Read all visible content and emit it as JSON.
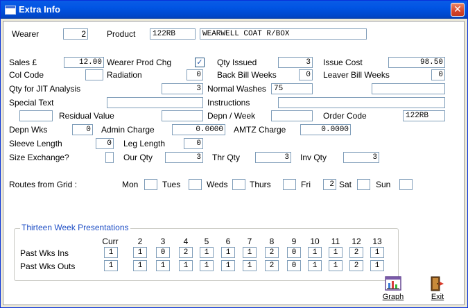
{
  "window": {
    "title": "Extra Info",
    "close_glyph": "✕"
  },
  "wearer": {
    "label": "Wearer",
    "value": "2"
  },
  "product": {
    "label": "Product",
    "code": "122RB",
    "description": "WEARWELL COAT R/BOX"
  },
  "sales": {
    "label": "Sales £",
    "value": "12.00"
  },
  "wearer_prod_chg": {
    "label": "Wearer Prod Chg",
    "checked_glyph": "✓"
  },
  "qty_issued": {
    "label": "Qty Issued",
    "value": "3"
  },
  "issue_cost": {
    "label": "Issue Cost",
    "value": "98.50"
  },
  "col_code": {
    "label": "Col Code",
    "value": ""
  },
  "radiation": {
    "label": "Radiation",
    "value": "0"
  },
  "back_bill_weeks": {
    "label": "Back Bill Weeks",
    "value": "0"
  },
  "leaver_bill_weeks": {
    "label": "Leaver Bill Weeks",
    "value": "0"
  },
  "qty_jit": {
    "label": "Qty for JIT Analysis",
    "value": "3"
  },
  "normal_washes": {
    "label": "Normal Washes",
    "value": "75"
  },
  "normal_washes_extra": {
    "value": ""
  },
  "special_text": {
    "label": "Special Text",
    "value": ""
  },
  "instructions": {
    "label": "Instructions",
    "value": ""
  },
  "residual_value": {
    "label": "Residual Value",
    "pre_value": "",
    "value": ""
  },
  "depn_week": {
    "label": "Depn / Week",
    "value": ""
  },
  "order_code": {
    "label": "Order Code",
    "value": "122RB"
  },
  "depn_wks": {
    "label": "Depn Wks",
    "value": "0"
  },
  "admin_charge": {
    "label": "Admin Charge",
    "value": "0.0000"
  },
  "amtz_charge": {
    "label": "AMTZ Charge",
    "value": "0.0000"
  },
  "sleeve_length": {
    "label": "Sleeve Length",
    "value": "0"
  },
  "leg_length": {
    "label": "Leg Length",
    "value": "0"
  },
  "size_exchange": {
    "label": "Size Exchange?",
    "value": ""
  },
  "our_qty": {
    "label": "Our Qty",
    "value": "3"
  },
  "thr_qty": {
    "label": "Thr Qty",
    "value": "3"
  },
  "inv_qty": {
    "label": "Inv Qty",
    "value": "3"
  },
  "routes": {
    "label": "Routes from Grid :",
    "days": [
      {
        "label": "Mon",
        "value": ""
      },
      {
        "label": "Tues",
        "value": ""
      },
      {
        "label": "Weds",
        "value": ""
      },
      {
        "label": "Thurs",
        "value": ""
      },
      {
        "label": "Fri",
        "value": "2"
      },
      {
        "label": "Sat",
        "value": ""
      },
      {
        "label": "Sun",
        "value": ""
      }
    ]
  },
  "thirteen_weeks": {
    "title": "Thirteen Week Presentations",
    "columns": [
      "Curr",
      "2",
      "3",
      "4",
      "5",
      "6",
      "7",
      "8",
      "9",
      "10",
      "11",
      "12",
      "13"
    ],
    "rows": [
      {
        "label": "Past Wks Ins",
        "values": [
          "1",
          "1",
          "0",
          "2",
          "1",
          "1",
          "1",
          "2",
          "0",
          "1",
          "1",
          "2",
          "1"
        ]
      },
      {
        "label": "Past Wks Outs",
        "values": [
          "1",
          "1",
          "1",
          "1",
          "1",
          "1",
          "1",
          "2",
          "0",
          "1",
          "1",
          "2",
          "1"
        ]
      }
    ]
  },
  "buttons": {
    "graph": "Graph",
    "exit": "Exit"
  }
}
